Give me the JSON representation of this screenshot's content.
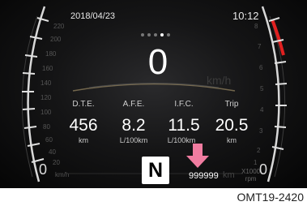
{
  "status": {
    "date": "2018/04/23",
    "time": "10:12"
  },
  "speed": {
    "value": "0",
    "unit": "km/h"
  },
  "info": [
    {
      "label": "D.T.E.",
      "value": "456",
      "unit": "km"
    },
    {
      "label": "A.F.E.",
      "value": "8.2",
      "unit": "L/100km"
    },
    {
      "label": "I.F.C.",
      "value": "11.5",
      "unit": "L/100km"
    },
    {
      "label": "Trip",
      "value": "20.5",
      "unit": "km"
    }
  ],
  "gear": "N",
  "odometer": {
    "value": "999999",
    "unit": "km"
  },
  "left_gauge": {
    "labels": [
      "220",
      "200",
      "180",
      "160",
      "140",
      "120",
      "100",
      "80",
      "60",
      "40",
      "20"
    ],
    "zero": "0",
    "unit": "km/h"
  },
  "right_gauge": {
    "labels": [
      "8",
      "7",
      "6",
      "5",
      "4",
      "3",
      "2",
      "1"
    ],
    "zero": "0",
    "unit_line1": "X1000",
    "unit_line2": "rpm",
    "redline_color": "#e02020"
  },
  "page_dots": {
    "count": 5,
    "active": 4
  },
  "arrow_color": "#f07ca0",
  "caption": "OMT19-2420"
}
